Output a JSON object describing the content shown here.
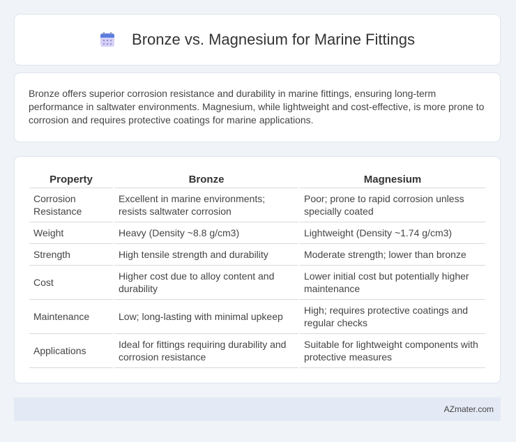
{
  "header": {
    "title": "Bronze vs. Magnesium for Marine Fittings",
    "icon": "calendar-icon"
  },
  "summary": {
    "text": "Bronze offers superior corrosion resistance and durability in marine fittings, ensuring long-term performance in saltwater environments. Magnesium, while lightweight and cost-effective, is more prone to corrosion and requires protective coatings for marine applications."
  },
  "table": {
    "headers": [
      "Property",
      "Bronze",
      "Magnesium"
    ],
    "rows": [
      {
        "property": "Corrosion Resistance",
        "bronze": "Excellent in marine environments; resists saltwater corrosion",
        "magnesium": "Poor; prone to rapid corrosion unless specially coated"
      },
      {
        "property": "Weight",
        "bronze": "Heavy (Density ~8.8 g/cm3)",
        "magnesium": "Lightweight (Density ~1.74 g/cm3)"
      },
      {
        "property": "Strength",
        "bronze": "High tensile strength and durability",
        "magnesium": "Moderate strength; lower than bronze"
      },
      {
        "property": "Cost",
        "bronze": "Higher cost due to alloy content and durability",
        "magnesium": "Lower initial cost but potentially higher maintenance"
      },
      {
        "property": "Maintenance",
        "bronze": "Low; long-lasting with minimal upkeep",
        "magnesium": "High; requires protective coatings and regular checks"
      },
      {
        "property": "Applications",
        "bronze": "Ideal for fittings requiring durability and corrosion resistance",
        "magnesium": "Suitable for lightweight components with protective measures"
      }
    ]
  },
  "footer": {
    "text": "AZmater.com"
  },
  "colors": {
    "background": "#f0f3f8",
    "icon_top": "#5b7de0",
    "icon_body": "#c9c3f2",
    "footer_bg": "#e4eaf5"
  }
}
